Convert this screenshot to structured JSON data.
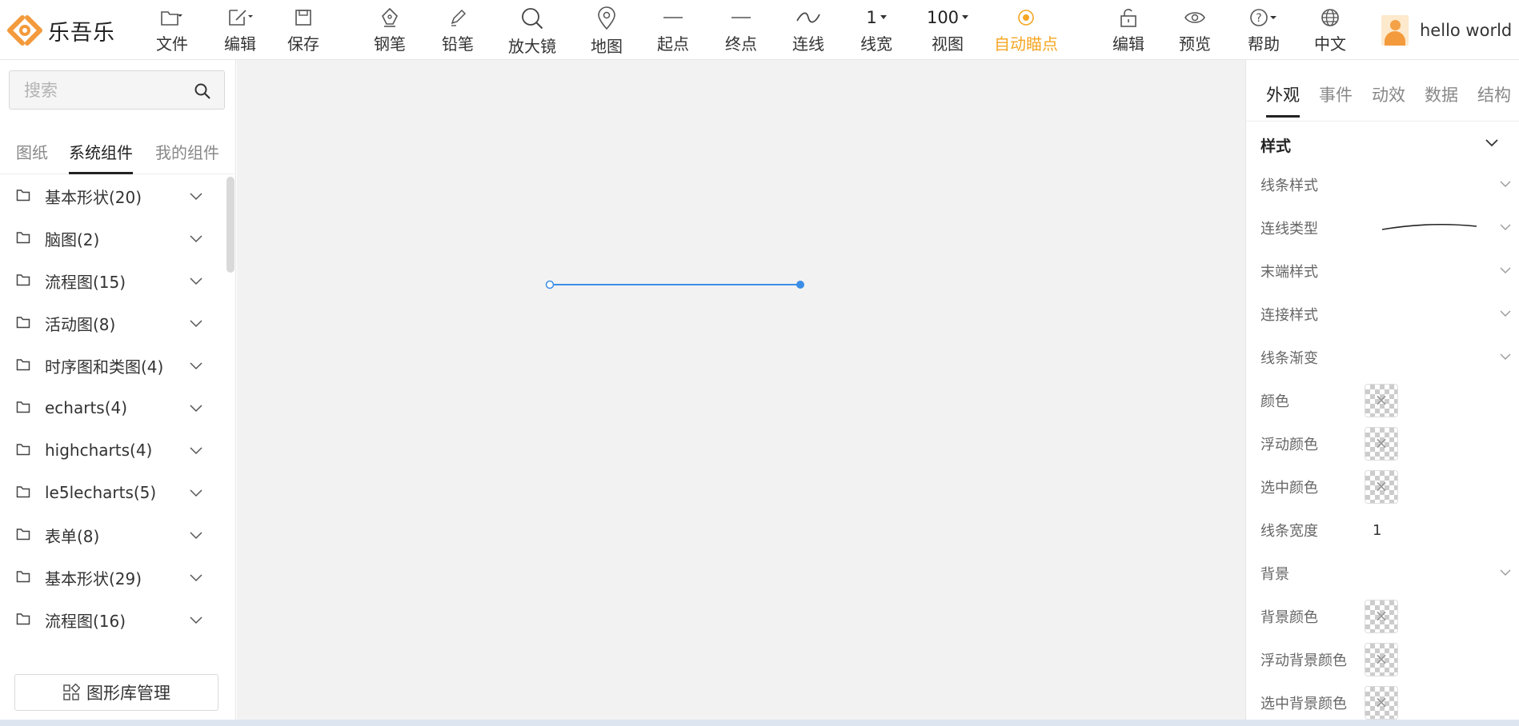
{
  "app": {
    "name": "乐吾乐"
  },
  "toolbar": {
    "file": "文件",
    "edit": "编辑",
    "save": "保存",
    "pen": "钢笔",
    "pencil": "铅笔",
    "magnifier": "放大镜",
    "map": "地图",
    "start": "起点",
    "end": "终点",
    "connect": "连线",
    "line_width_value": "1",
    "line_width": "线宽",
    "view_value": "100",
    "view": "视图",
    "auto_anchor": "自动瞄点",
    "edit2": "编辑",
    "preview": "预览",
    "help": "帮助",
    "language": "中文",
    "active_color": "#f5a623"
  },
  "user": {
    "name": "hello world"
  },
  "sidebar": {
    "search_placeholder": "搜索",
    "tabs": [
      "图纸",
      "系统组件",
      "我的组件"
    ],
    "active_tab": "系统组件",
    "items": [
      "基本形状(20)",
      "脑图(2)",
      "流程图(15)",
      "活动图(8)",
      "时序图和类图(4)",
      "echarts(4)",
      "highcharts(4)",
      "le5lecharts(5)",
      "表单(8)",
      "基本形状(29)",
      "流程图(16)"
    ],
    "library_button": "图形库管理"
  },
  "canvas": {
    "line_color": "#3a8ee6",
    "background": "#f2f2f2"
  },
  "panel": {
    "tabs": [
      "外观",
      "事件",
      "动效",
      "数据",
      "结构"
    ],
    "active_tab": "外观",
    "section_title": "样式",
    "line_style": "线条样式",
    "connect_type": "连线类型",
    "end_style": "末端样式",
    "join_style": "连接样式",
    "line_gradient": "线条渐变",
    "color": "颜色",
    "hover_color": "浮动颜色",
    "selected_color": "选中颜色",
    "line_width": "线条宽度",
    "line_width_value": "1",
    "background": "背景",
    "bg_color": "背景颜色",
    "hover_bg_color": "浮动背景颜色",
    "selected_bg_color": "选中背景颜色"
  }
}
